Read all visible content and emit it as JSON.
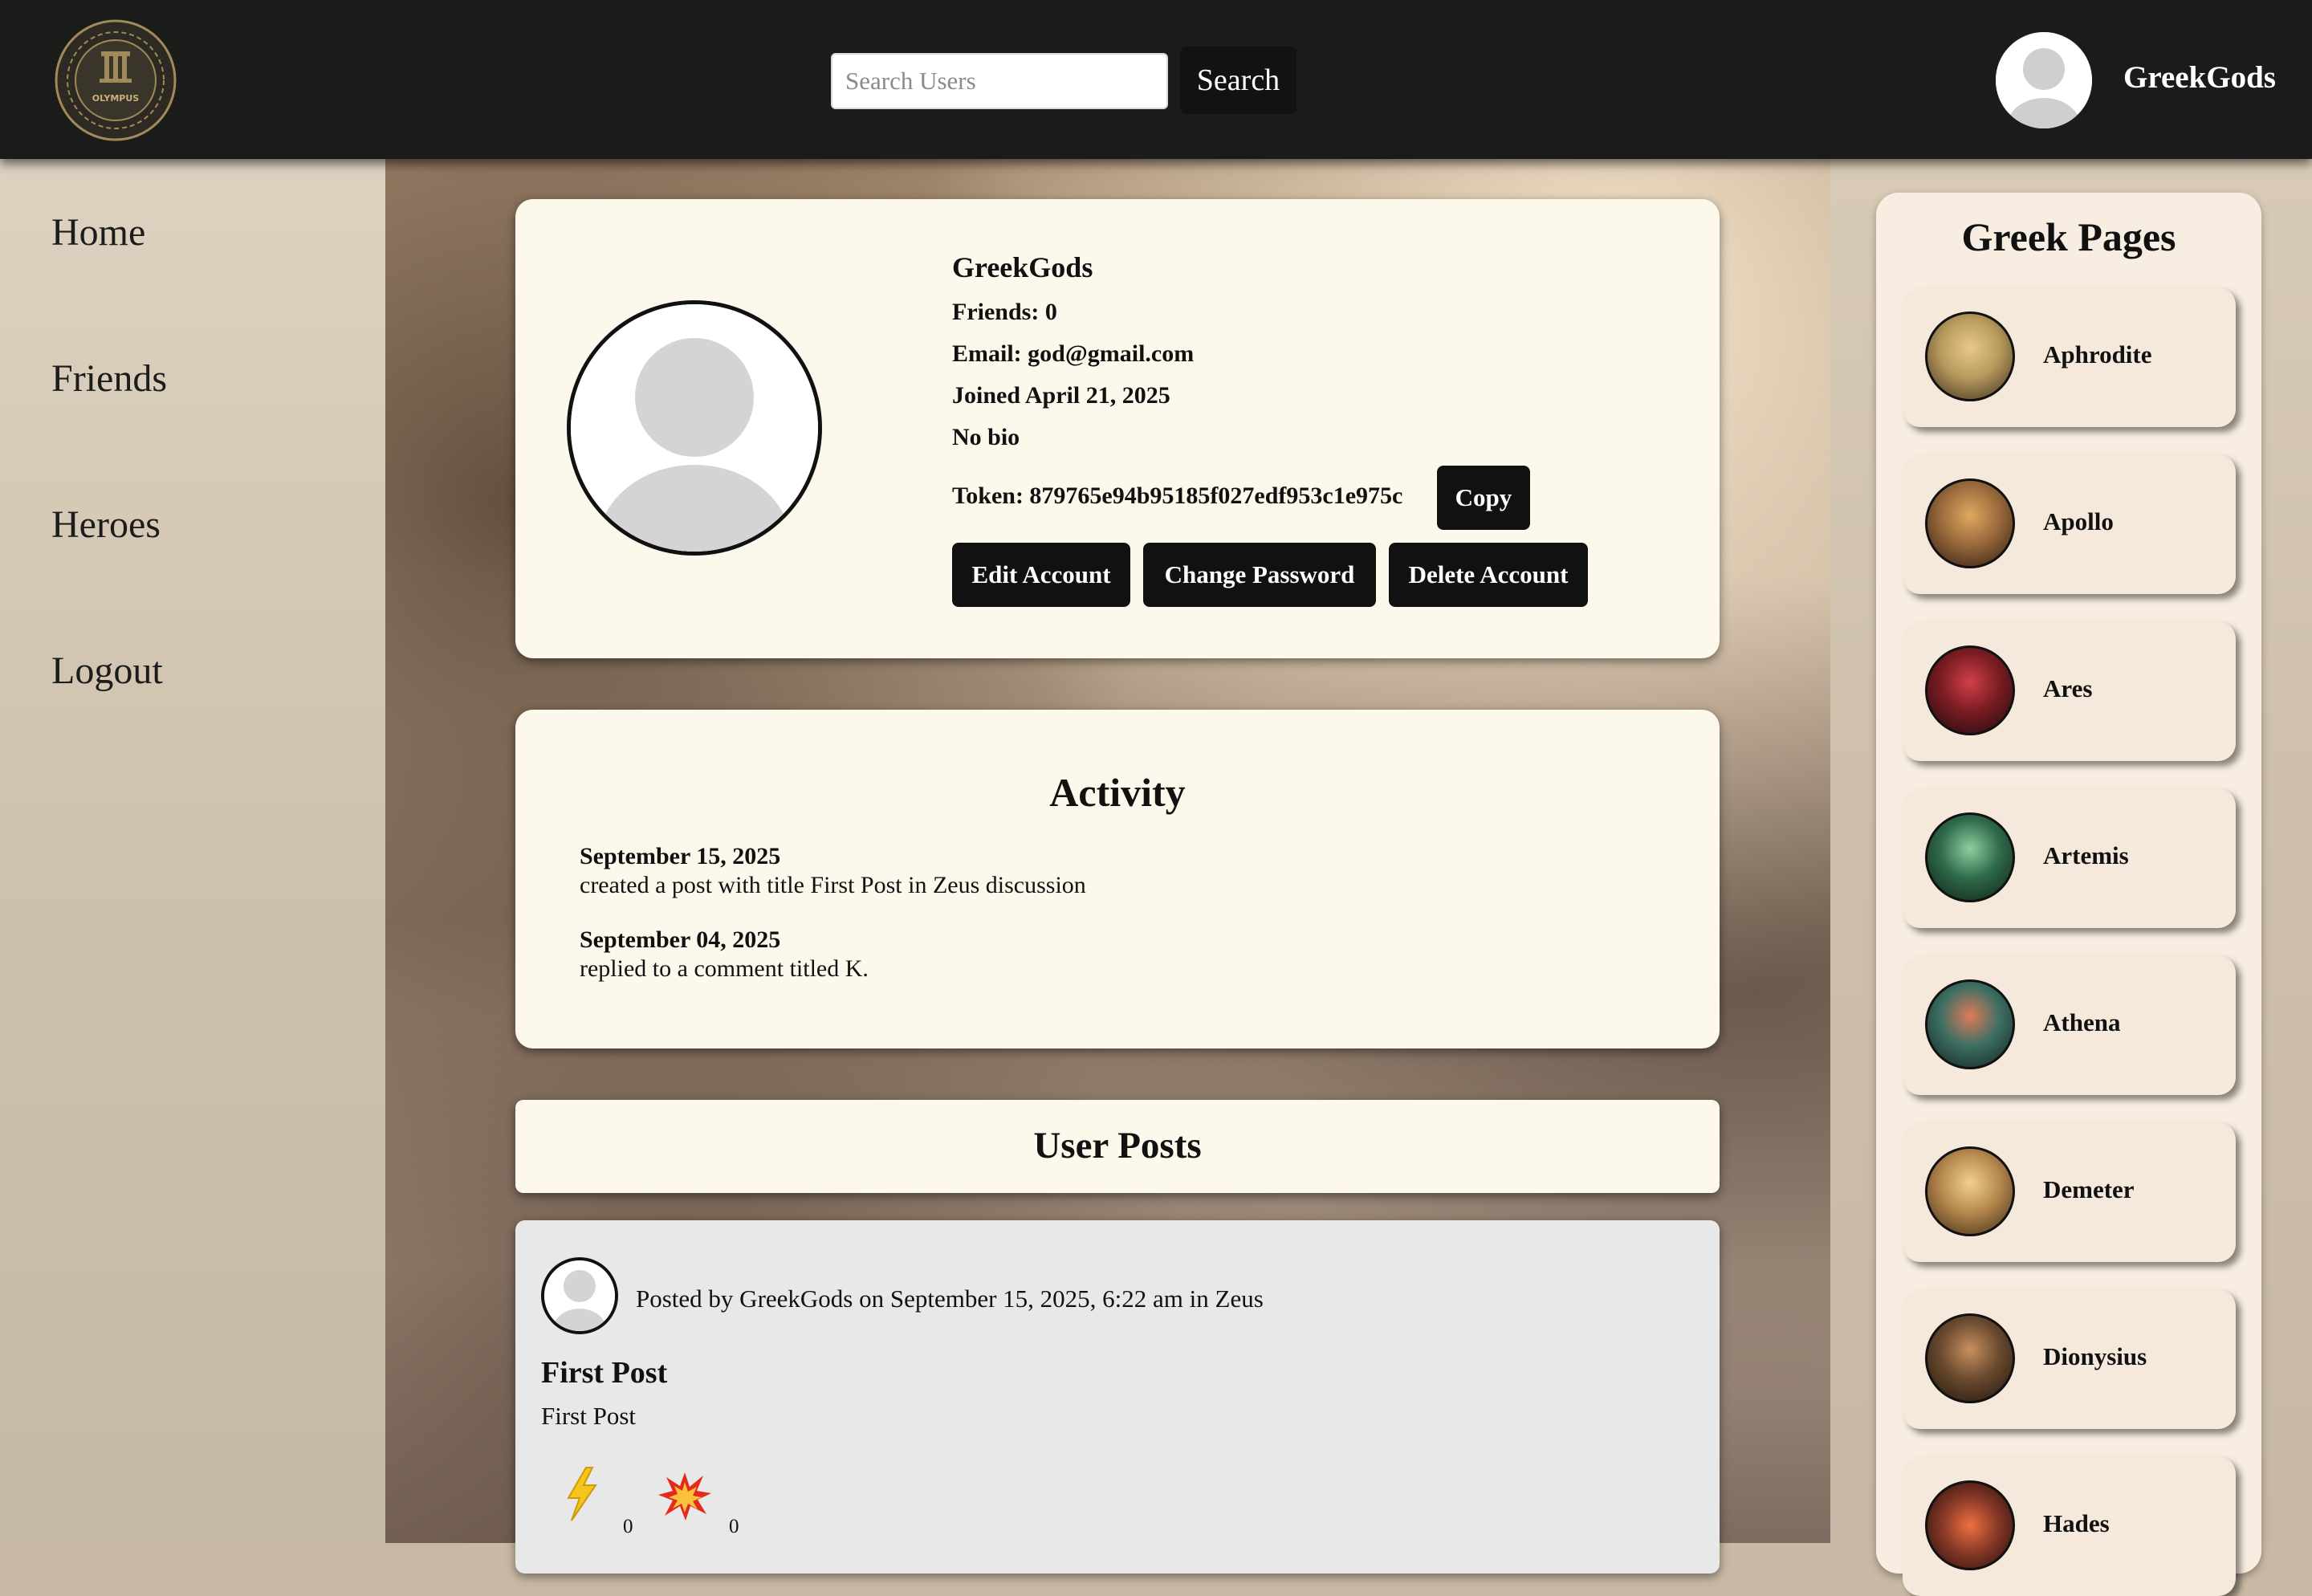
{
  "header": {
    "logo_text": "OLYMPUS",
    "search_placeholder": "Search Users",
    "search_button": "Search",
    "username": "GreekGods"
  },
  "sidebar": {
    "items": [
      {
        "label": "Home"
      },
      {
        "label": "Friends"
      },
      {
        "label": "Heroes"
      },
      {
        "label": "Logout"
      }
    ]
  },
  "profile": {
    "username": "GreekGods",
    "friends": "Friends: 0",
    "email": "Email: god@gmail.com",
    "joined": "Joined April 21, 2025",
    "bio": "No bio",
    "token": "Token: 879765e94b95185f027edf953c1e975c",
    "copy_label": "Copy",
    "edit_label": "Edit Account",
    "change_password_label": "Change Password",
    "delete_label": "Delete Account"
  },
  "activity": {
    "title": "Activity",
    "entries": [
      {
        "date": "September 15, 2025",
        "text": "created a post with title First Post in Zeus discussion"
      },
      {
        "date": "September 04, 2025",
        "text": "replied to a comment titled K."
      }
    ]
  },
  "posts": {
    "title": "User Posts",
    "items": [
      {
        "meta": "Posted by GreekGods on September 15, 2025, 6:22 am in Zeus",
        "title": "First Post",
        "body": "First Post",
        "reactions": [
          {
            "icon": "lightning-icon",
            "count": "0"
          },
          {
            "icon": "explosion-icon",
            "count": "0"
          }
        ]
      }
    ]
  },
  "greek_pages": {
    "title": "Greek Pages",
    "items": [
      {
        "name": "Aphrodite",
        "color": "#b89a5e"
      },
      {
        "name": "Apollo",
        "color": "#9a6a3c"
      },
      {
        "name": "Ares",
        "color": "#7a1c22"
      },
      {
        "name": "Artemis",
        "color": "#2f6a4a"
      },
      {
        "name": "Athena",
        "color": "#3d6f63"
      },
      {
        "name": "Demeter",
        "color": "#b7884e"
      },
      {
        "name": "Dionysius",
        "color": "#6a4a2e"
      },
      {
        "name": "Hades",
        "color": "#8a3a28"
      }
    ]
  },
  "colors": {
    "header_bg": "#1b1b19",
    "card_bg": "#fdf8ec",
    "button_bg": "#111111",
    "post_bg": "#e8e8e8"
  }
}
